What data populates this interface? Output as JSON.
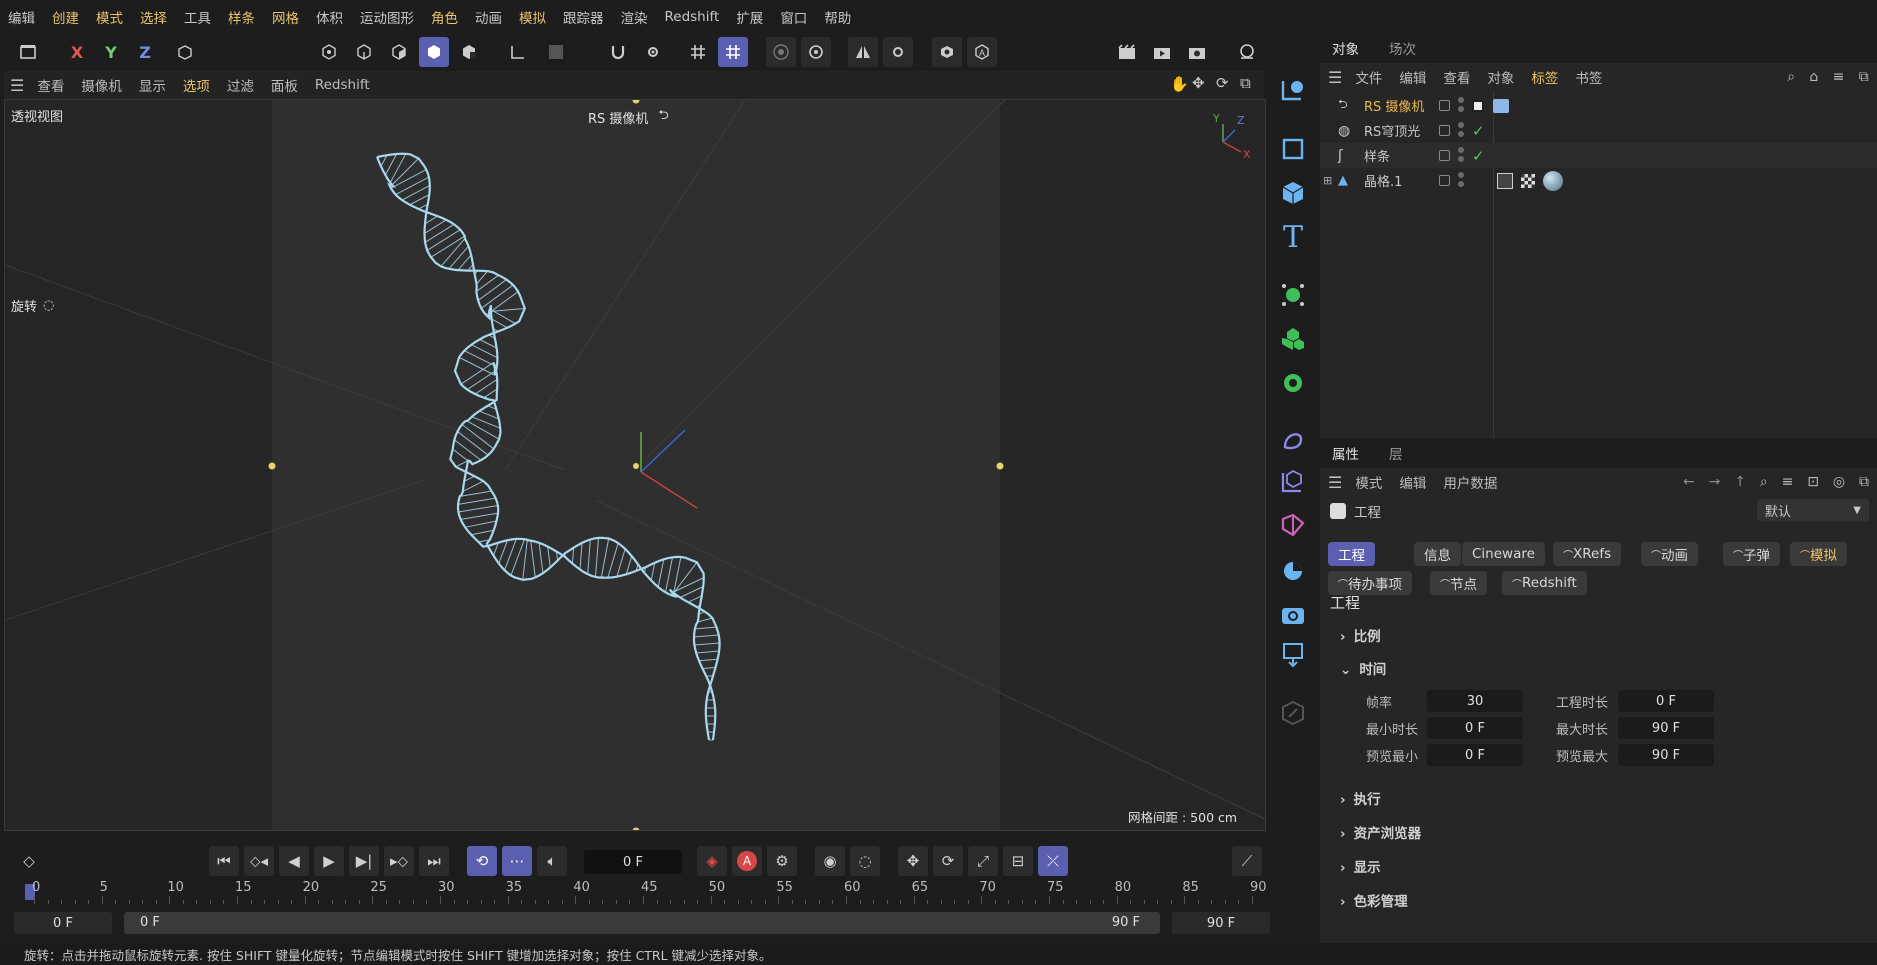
{
  "menubar": [
    {
      "label": "编辑",
      "hl": false
    },
    {
      "label": "创建",
      "hl": true
    },
    {
      "label": "模式",
      "hl": true
    },
    {
      "label": "选择",
      "hl": true
    },
    {
      "label": "工具",
      "hl": false
    },
    {
      "label": "样条",
      "hl": true
    },
    {
      "label": "网格",
      "hl": true
    },
    {
      "label": "体积",
      "hl": false
    },
    {
      "label": "运动图形",
      "hl": false
    },
    {
      "label": "角色",
      "hl": true
    },
    {
      "label": "动画",
      "hl": false
    },
    {
      "label": "模拟",
      "hl": true
    },
    {
      "label": "跟踪器",
      "hl": false
    },
    {
      "label": "渲染",
      "hl": false
    },
    {
      "label": "Redshift",
      "hl": false
    },
    {
      "label": "扩展",
      "hl": false
    },
    {
      "label": "窗口",
      "hl": false
    },
    {
      "label": "帮助",
      "hl": false
    }
  ],
  "toolbar": {
    "axis_x": "X",
    "axis_y": "Y",
    "axis_z": "Z"
  },
  "viewport_menu": [
    {
      "label": "查看",
      "hl": false
    },
    {
      "label": "摄像机",
      "hl": false
    },
    {
      "label": "显示",
      "hl": false
    },
    {
      "label": "选项",
      "hl": true
    },
    {
      "label": "过滤",
      "hl": false
    },
    {
      "label": "面板",
      "hl": false
    },
    {
      "label": "Redshift",
      "hl": false
    }
  ],
  "viewport": {
    "view_name": "透视视图",
    "camera_label": "RS 摄像机",
    "mode_label": "旋转",
    "grid_spacing": "网格间距 : 500 cm",
    "axis_labels": {
      "x": "X",
      "y": "Y",
      "z": "Z"
    }
  },
  "object_panel": {
    "tabs": [
      "对象",
      "场次"
    ],
    "menu": [
      {
        "label": "文件",
        "hl": false
      },
      {
        "label": "编辑",
        "hl": false
      },
      {
        "label": "查看",
        "hl": false
      },
      {
        "label": "对象",
        "hl": false
      },
      {
        "label": "标签",
        "hl": true
      },
      {
        "label": "书签",
        "hl": false
      }
    ],
    "objects": [
      {
        "name": "RS 摄像机",
        "active": true
      },
      {
        "name": "RS穹顶光",
        "active": false
      },
      {
        "name": "样条",
        "active": false
      },
      {
        "name": "晶格.1",
        "active": false
      }
    ]
  },
  "attr_panel": {
    "tabs": [
      "属性",
      "层"
    ],
    "menu": [
      "模式",
      "编辑",
      "用户数据"
    ],
    "context": "工程",
    "preset": "默认",
    "pills_row1": [
      "工程",
      "信息",
      "Cineware",
      "XRefs",
      "动画",
      "子弹",
      "模拟"
    ],
    "pills_row2": [
      "待办事项",
      "节点",
      "Redshift"
    ],
    "section_title": "工程",
    "groups": {
      "scale": "比例",
      "time": "时间",
      "execute": "执行",
      "asset_browser": "资产浏览器",
      "display": "显示",
      "color_mgmt": "色彩管理"
    },
    "time_fields": {
      "fps_label": "帧率",
      "fps": "30",
      "duration_label": "工程时长",
      "duration": "0 F",
      "min_label": "最小时长",
      "min": "0 F",
      "max_label": "最大时长",
      "max": "90 F",
      "pmin_label": "预览最小",
      "pmin": "0 F",
      "pmax_label": "预览最大",
      "pmax": "90 F"
    }
  },
  "timeline": {
    "current_frame": "0 F",
    "ruler_ticks": [
      "0",
      "5",
      "10",
      "15",
      "20",
      "25",
      "30",
      "35",
      "40",
      "45",
      "50",
      "55",
      "60",
      "65",
      "70",
      "75",
      "80",
      "85",
      "90"
    ],
    "range_start": "0 F",
    "range_inner_start": "0 F",
    "range_inner_end": "90 F",
    "range_end": "90 F"
  },
  "status": "旋转：点击并拖动鼠标旋转元素. 按住 SHIFT 键量化旋转；节点编辑模式时按住 SHIFT 键增加选择对象；按住 CTRL 键减少选择对象。",
  "colors": {
    "accent": "#5a5fb0",
    "highlight": "#e9c46a",
    "dna": "#a9d8ee"
  }
}
